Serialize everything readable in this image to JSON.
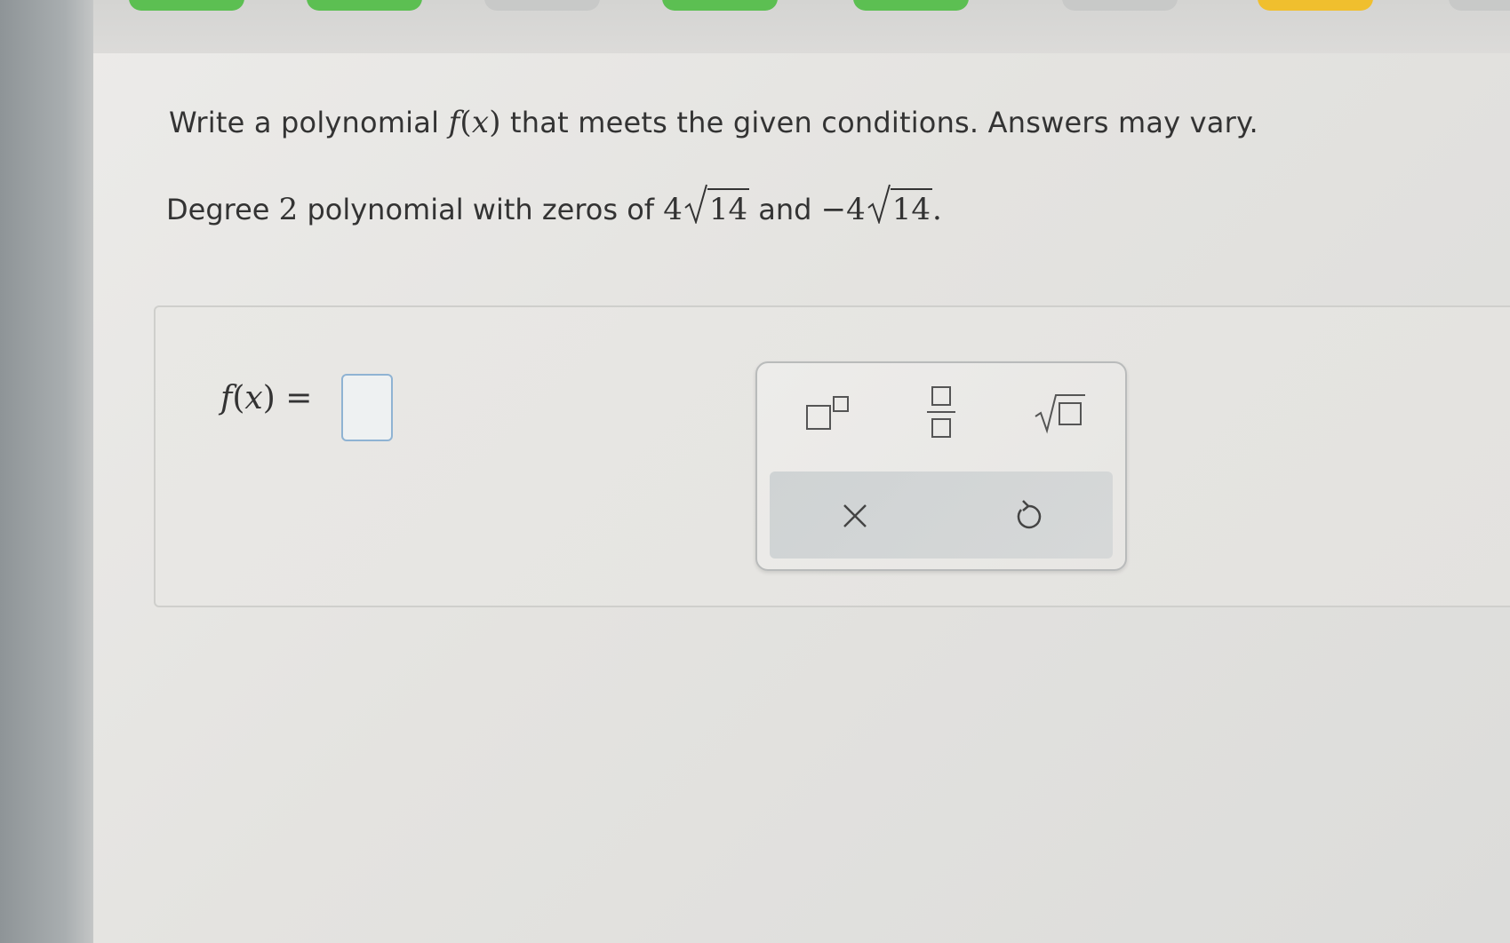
{
  "question": {
    "prompt_before": "Write a polynomial",
    "prompt_func": "f",
    "prompt_var": "x",
    "prompt_after": "that meets the given conditions. Answers may vary.",
    "condition_prefix": "Degree",
    "degree": "2",
    "condition_middle": "polynomial with zeros of",
    "zero1_coef": "4",
    "zero1_radicand": "14",
    "condition_and": "and",
    "zero2_coef": "−4",
    "zero2_radicand": "14",
    "condition_end": "."
  },
  "answer": {
    "func": "f",
    "var": "x",
    "equals": "=",
    "value": ""
  },
  "keypad": {
    "keys": [
      {
        "name": "exponent",
        "icon": "exponent-template-icon"
      },
      {
        "name": "fraction",
        "icon": "fraction-template-icon"
      },
      {
        "name": "square-root",
        "icon": "square-root-template-icon"
      },
      {
        "name": "clear",
        "icon": "close-icon",
        "label": "×"
      },
      {
        "name": "undo",
        "icon": "undo-icon"
      }
    ]
  },
  "colors": {
    "progress_green": "#5cbf52",
    "progress_gray": "#c8c9c8",
    "progress_yellow": "#f0bf2e",
    "answer_box_border": "#8fb3d3",
    "text": "#333333"
  }
}
